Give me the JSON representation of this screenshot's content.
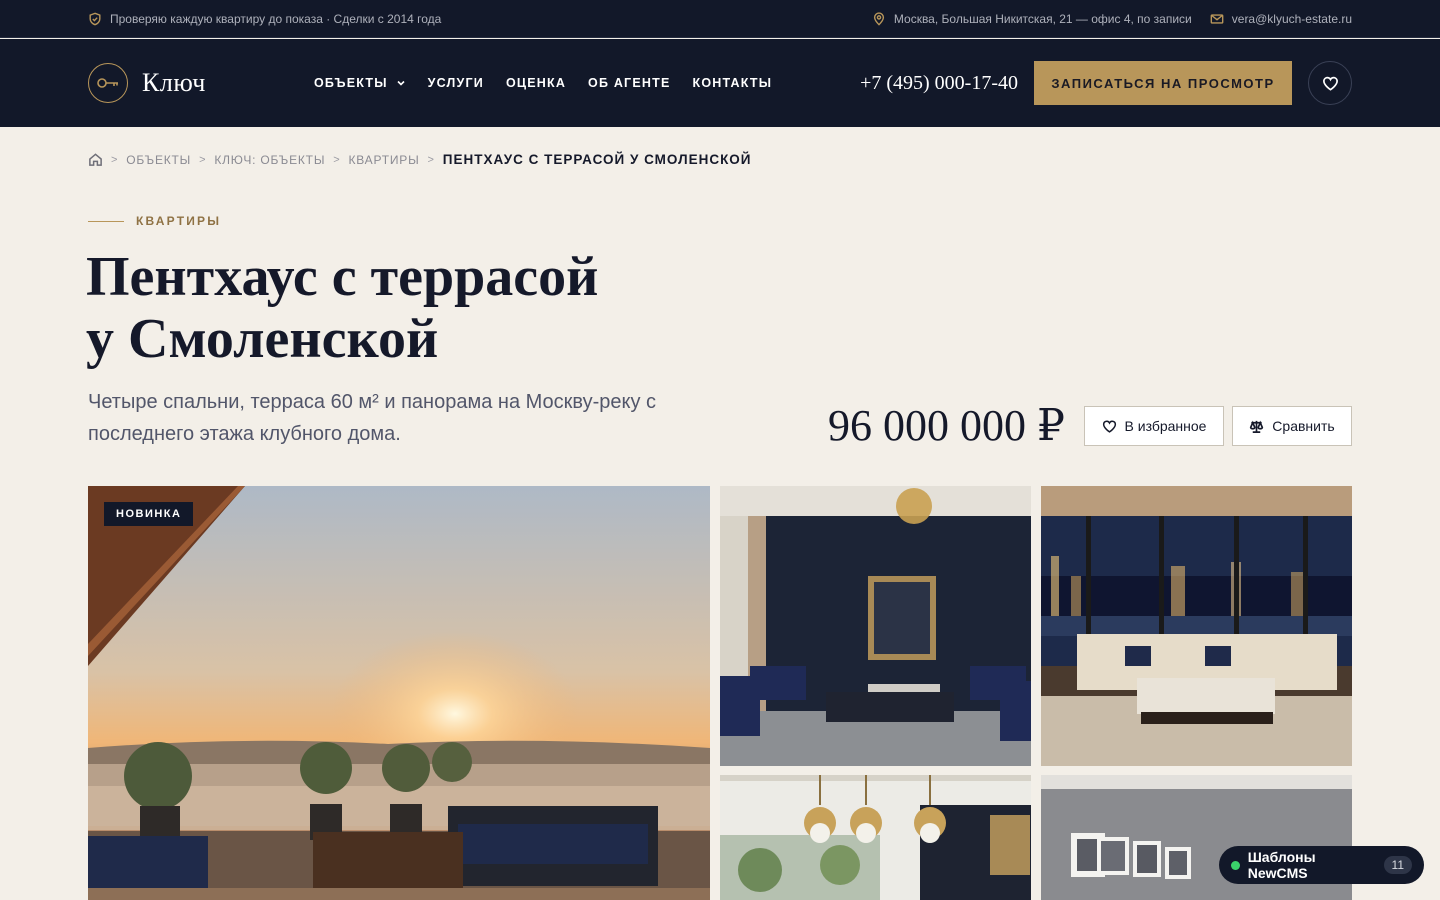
{
  "topbar": {
    "left_text": "Проверяю каждую квартиру до показа · Сделки с 2014 года",
    "address": "Москва, Большая Никитская, 21 — офис 4, по записи",
    "email": "vera@klyuch-estate.ru"
  },
  "header": {
    "logo_text": "Ключ",
    "nav": [
      "ОБЪЕКТЫ",
      "УСЛУГИ",
      "ОЦЕНКА",
      "ОБ АГЕНТЕ",
      "КОНТАКТЫ"
    ],
    "phone": "+7 (495) 000-17-40",
    "cta_label": "ЗАПИСАТЬСЯ НА ПРОСМОТР"
  },
  "breadcrumb": [
    "ОБЪЕКТЫ",
    "КЛЮЧ: ОБЪЕКТЫ",
    "КВАРТИРЫ",
    "ПЕНТХАУС С ТЕРРАСОЙ У СМОЛЕНСКОЙ"
  ],
  "listing": {
    "eyebrow": "КВАРТИРЫ",
    "title_line1": "Пентхаус с террасой",
    "title_line2": "у Смоленской",
    "subtitle": "Четыре спальни, терраса 60 м² и панорама на Москву-реку с последнего этажа клубного дома.",
    "price": "96 000 000 ₽",
    "favorite_label": "В избранное",
    "compare_label": "Сравнить",
    "badge": "НОВИНКА"
  },
  "widget": {
    "label": "Шаблоны NewCMS",
    "count": "11"
  },
  "colors": {
    "navy": "#121829",
    "gold": "#b8965a",
    "background": "#f3efe8"
  }
}
